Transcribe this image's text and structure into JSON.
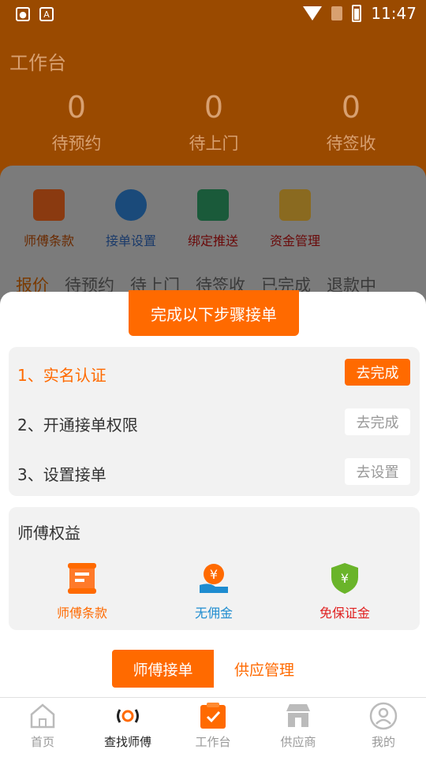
{
  "status_bar": {
    "time": "11:47",
    "icons": [
      "lock-icon",
      "a-box-icon",
      "wifi-icon",
      "sim-icon",
      "battery-icon"
    ]
  },
  "header": {
    "title": "工作台",
    "stats": [
      {
        "value": "0",
        "label": "待预约"
      },
      {
        "value": "0",
        "label": "待上门"
      },
      {
        "value": "0",
        "label": "待签收"
      }
    ]
  },
  "quick_actions": [
    {
      "label": "师傅条款",
      "icon": "scroll-icon",
      "color": "#8a3a10"
    },
    {
      "label": "接单设置",
      "icon": "gear-icon",
      "color": "#1a4a7a"
    },
    {
      "label": "绑定推送",
      "icon": "bind-icon",
      "color": "#7a1010"
    },
    {
      "label": "资金管理",
      "icon": "money-bag-icon",
      "color": "#7a1010"
    }
  ],
  "order_tabs": [
    "报价",
    "待预约",
    "待上门",
    "待签收",
    "已完成",
    "退款中"
  ],
  "modal": {
    "title": "完成以下步骤接单",
    "steps": [
      {
        "label": "1、实名认证",
        "button": "去完成"
      },
      {
        "label": "2、开通接单权限",
        "button": "去完成"
      },
      {
        "label": "3、设置接单",
        "button": "去设置"
      }
    ],
    "benefits_title": "师傅权益",
    "benefits": [
      {
        "label": "师傅条款",
        "icon": "scroll-icon",
        "color": "#ff6a00"
      },
      {
        "label": "无佣金",
        "icon": "no-commission-icon",
        "color": "#1e8cd0"
      },
      {
        "label": "免保证金",
        "icon": "shield-yen-icon",
        "color": "#e02020"
      }
    ],
    "segments": [
      "师傅接单",
      "供应管理"
    ]
  },
  "bottom_nav": [
    {
      "label": "首页",
      "icon": "home-icon"
    },
    {
      "label": "查找师傅",
      "icon": "find-master-icon"
    },
    {
      "label": "工作台",
      "icon": "workbench-icon"
    },
    {
      "label": "供应商",
      "icon": "store-icon"
    },
    {
      "label": "我的",
      "icon": "user-icon"
    }
  ],
  "colors": {
    "accent": "#ff6a00",
    "header_dimmed": "#9a4a00"
  }
}
